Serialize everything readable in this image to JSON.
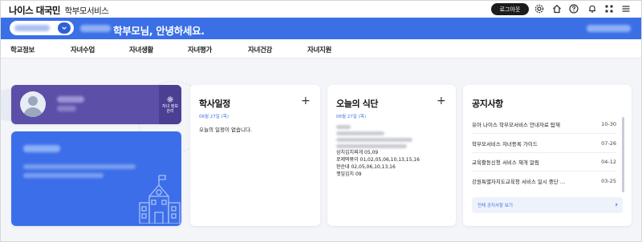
{
  "header": {
    "logo_main": "나이스 대국민",
    "logo_sub": "학부모서비스",
    "logout_label": "로그아웃",
    "icons": [
      "gear-icon",
      "home-icon",
      "help-icon",
      "bell-icon",
      "grid-icon",
      "menu-icon"
    ]
  },
  "band": {
    "greeting": "학부모님, 안녕하세요.",
    "accent": "#3b6fe6"
  },
  "nav": {
    "items": [
      "학교정보",
      "자녀수업",
      "자녀생활",
      "자녀평가",
      "자녀건강",
      "자녀지원"
    ]
  },
  "profile": {
    "manage_label_1": "자녀 정보",
    "manage_label_2": "관리",
    "color": "#5b4fa8"
  },
  "schedule": {
    "title": "학사일정",
    "date": "06월 27일 (목)",
    "empty": "오늘의 일정이 없습니다."
  },
  "meal": {
    "title": "오늘의 식단",
    "date": "06월 27일 (목)",
    "lines": [
      "삼치김치찌개 05,09",
      "로제떡볶이 01,02,05,06,10,13,15,16",
      "현순대 02,05,06,10,13,16",
      "깻잎김치 09"
    ]
  },
  "notice": {
    "title": "공지사항",
    "items": [
      {
        "title": "유아 나이스 학부모서비스 안내자료 탑재",
        "date": "10-30"
      },
      {
        "title": "학부모서비스 자녀등록 가이드",
        "date": "07-26"
      },
      {
        "title": "교육활동신청 서비스 재개 알림",
        "date": "04-12"
      },
      {
        "title": "강원특별자치도교육청 서비스 일시 중단 …",
        "date": "03-25"
      }
    ],
    "all_label": "전체 공지사항 보기"
  }
}
